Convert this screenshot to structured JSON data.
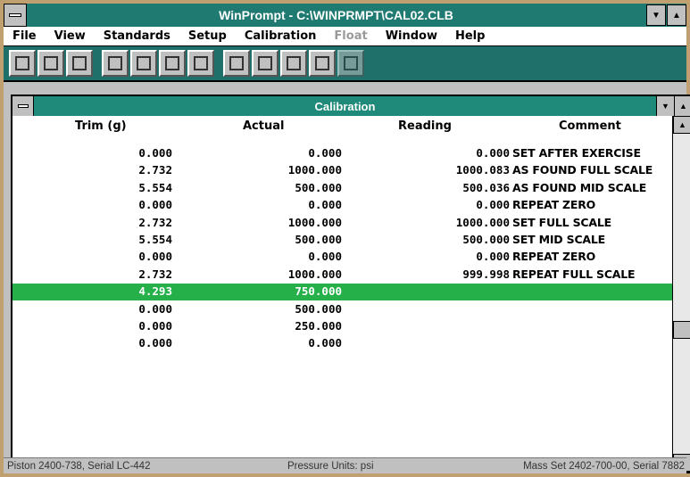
{
  "window": {
    "title": "WinPrompt - C:\\WINPRMPT\\CAL02.CLB"
  },
  "menu": [
    "File",
    "View",
    "Standards",
    "Setup",
    "Calibration",
    "Float",
    "Window",
    "Help"
  ],
  "menu_disabled": [
    "Float"
  ],
  "toolbar": {
    "icons": [
      "new-icon",
      "open-icon",
      "save-icon",
      "print-icon",
      "lock-icon",
      "database-icon",
      "blank-icon",
      "grid-icon",
      "text-icon",
      "cancel-icon",
      "export-icon",
      "chart-icon"
    ]
  },
  "child": {
    "title": "Calibration",
    "columns": [
      "Trim (g)",
      "Actual",
      "Reading",
      "Comment"
    ],
    "rows": [
      {
        "trim": "0.000",
        "actual": "0.000",
        "reading": "0.000",
        "comment": "SET AFTER EXERCISE"
      },
      {
        "trim": "2.732",
        "actual": "1000.000",
        "reading": "1000.083",
        "comment": "AS FOUND FULL SCALE"
      },
      {
        "trim": "5.554",
        "actual": "500.000",
        "reading": "500.036",
        "comment": "AS FOUND MID SCALE"
      },
      {
        "trim": "0.000",
        "actual": "0.000",
        "reading": "0.000",
        "comment": "REPEAT ZERO"
      },
      {
        "trim": "2.732",
        "actual": "1000.000",
        "reading": "1000.000",
        "comment": "SET FULL SCALE"
      },
      {
        "trim": "5.554",
        "actual": "500.000",
        "reading": "500.000",
        "comment": "SET MID SCALE"
      },
      {
        "trim": "0.000",
        "actual": "0.000",
        "reading": "0.000",
        "comment": "REPEAT ZERO"
      },
      {
        "trim": "2.732",
        "actual": "1000.000",
        "reading": "999.998",
        "comment": "REPEAT FULL SCALE"
      },
      {
        "trim": "4.293",
        "actual": "750.000",
        "reading": "",
        "comment": "",
        "selected": true
      },
      {
        "trim": "0.000",
        "actual": "500.000",
        "reading": "",
        "comment": ""
      },
      {
        "trim": "0.000",
        "actual": "250.000",
        "reading": "",
        "comment": ""
      },
      {
        "trim": "0.000",
        "actual": "0.000",
        "reading": "",
        "comment": ""
      }
    ]
  },
  "status": {
    "left": "Piston 2400-738, Serial LC-442",
    "middle": "Pressure Units: psi",
    "right": "Mass Set 2402-700-00, Serial 7882"
  },
  "colors": {
    "title": "#1f7a72",
    "selection": "#26b04a"
  }
}
